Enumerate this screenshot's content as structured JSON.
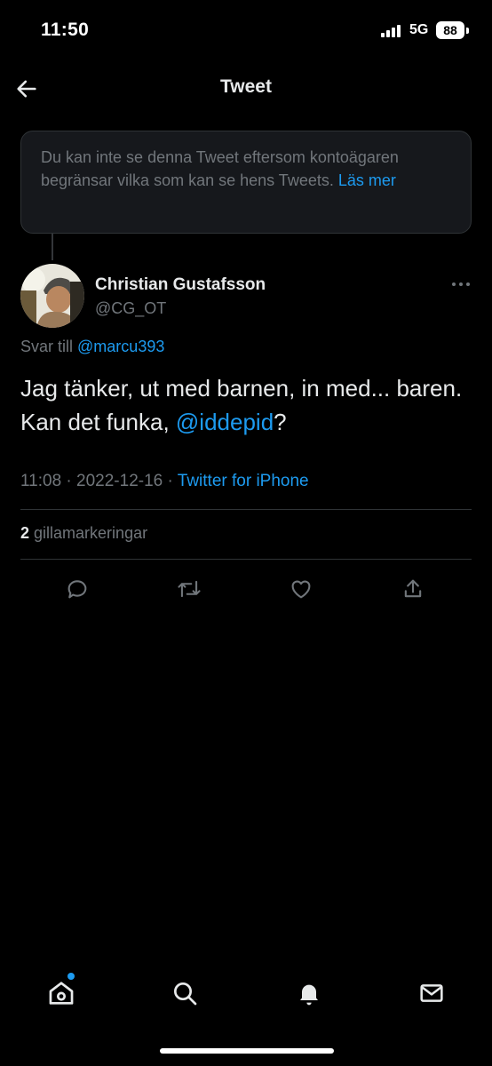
{
  "status": {
    "time": "11:50",
    "network": "5G",
    "battery": "88"
  },
  "header": {
    "title": "Tweet",
    "back_icon": "arrow-left-icon"
  },
  "notice": {
    "text": "Du kan inte se denna Tweet eftersom kontoägaren begränsar vilka som kan se hens Tweets.",
    "link": "Läs mer"
  },
  "tweet": {
    "author_name": "Christian Gustafsson",
    "author_handle": "@CG_OT",
    "reply_prefix": "Svar till",
    "reply_mention": "@marcu393",
    "text_before": "Jag tänker, ut med barnen, in med... baren. Kan det funka, ",
    "text_mention": "@iddepid",
    "text_after": "?",
    "time": "11:08",
    "date": "2022-12-16",
    "source": "Twitter for iPhone",
    "likes_count": "2",
    "likes_label": "gillamarkeringar"
  },
  "actions": [
    "reply-icon",
    "retweet-icon",
    "like-icon",
    "share-icon"
  ],
  "tabbar": {
    "items": [
      "home-icon",
      "search-icon",
      "notifications-icon",
      "messages-icon"
    ],
    "home_has_dot": true,
    "accent": "#1d9bf0"
  }
}
